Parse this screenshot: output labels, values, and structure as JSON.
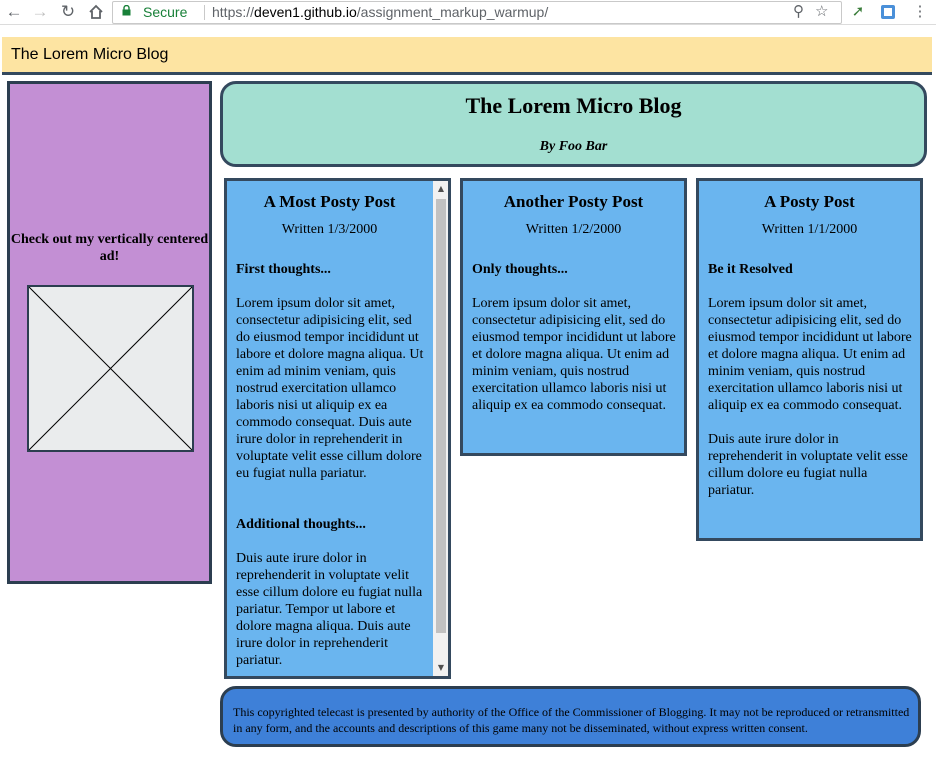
{
  "browser": {
    "secure_label": "Secure",
    "url_scheme": "https://",
    "url_host": "deven1.github.io",
    "url_path": "/assignment_markup_warmup/"
  },
  "topbar": {
    "title": "The Lorem Micro Blog"
  },
  "ad": {
    "text": "Check out my vertically centered ad!"
  },
  "header": {
    "title": "The Lorem Micro Blog",
    "byline": "By Foo Bar"
  },
  "posts": [
    {
      "title": "A Most Posty Post",
      "date": "Written 1/3/2000",
      "sections": [
        {
          "heading": "First thoughts...",
          "paragraphs": [
            "Lorem ipsum dolor sit amet, consectetur adipisicing elit, sed do eiusmod tempor incididunt ut labore et dolore magna aliqua. Ut enim ad minim veniam, quis nostrud exercitation ullamco laboris nisi ut aliquip ex ea commodo consequat. Duis aute irure dolor in reprehenderit in voluptate velit esse cillum dolore eu fugiat nulla pariatur."
          ]
        },
        {
          "heading": "Additional thoughts...",
          "paragraphs": [
            "Duis aute irure dolor in reprehenderit in voluptate velit esse cillum dolore eu fugiat nulla pariatur. Tempor ut labore et dolore magna aliqua. Duis aute irure dolor in reprehenderit pariatur."
          ]
        }
      ]
    },
    {
      "title": "Another Posty Post",
      "date": "Written 1/2/2000",
      "sections": [
        {
          "heading": "Only thoughts...",
          "paragraphs": [
            "Lorem ipsum dolor sit amet, consectetur adipisicing elit, sed do eiusmod tempor incididunt ut labore et dolore magna aliqua. Ut enim ad minim veniam, quis nostrud exercitation ullamco laboris nisi ut aliquip ex ea commodo consequat."
          ]
        }
      ]
    },
    {
      "title": "A Posty Post",
      "date": "Written 1/1/2000",
      "sections": [
        {
          "heading": "Be it Resolved",
          "paragraphs": [
            "Lorem ipsum dolor sit amet, consectetur adipisicing elit, sed do eiusmod tempor incididunt ut labore et dolore magna aliqua. Ut enim ad minim veniam, quis nostrud exercitation ullamco laboris nisi ut aliquip ex ea commodo consequat.",
            "Duis aute irure dolor in reprehenderit in voluptate velit esse cillum dolore eu fugiat nulla pariatur."
          ]
        }
      ]
    }
  ],
  "footer": {
    "text": "This copyrighted telecast is presented by authority of the Office of the Commissioner of Blogging. It may not be reproduced or retransmitted in any form, and the accounts and descriptions of this game many not be disseminated, without express written consent."
  },
  "colors": {
    "topbar": "#fde4a2",
    "ad": "#c38fd4",
    "header": "#a3dfd1",
    "post": "#6ab5ef",
    "footer": "#3e80d8",
    "border": "#34495e"
  }
}
